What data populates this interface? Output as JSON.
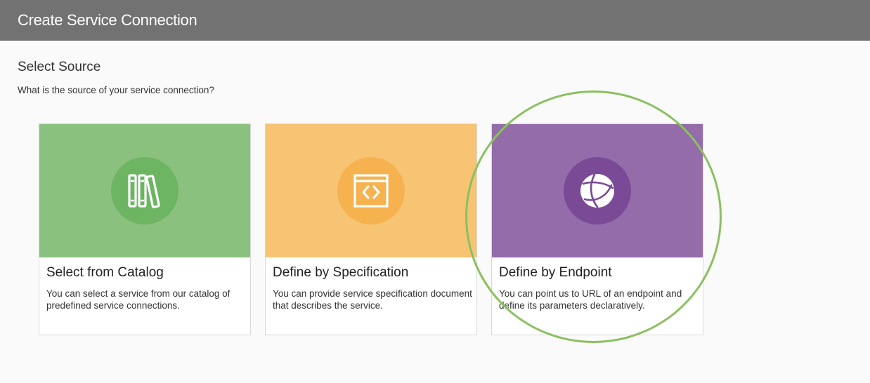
{
  "header": {
    "title": "Create Service Connection",
    "background": "#727272"
  },
  "section": {
    "title": "Select Source",
    "subtitle": "What is the source of your service connection?"
  },
  "cards": [
    {
      "title": "Select from Catalog",
      "description": "You can select a service from our catalog of predefined service connections.",
      "icon": "books-icon",
      "banner_color": "#8bc17f",
      "circle_color": "#6db463"
    },
    {
      "title": "Define by Specification",
      "description": "You can provide service specification document that describes the service.",
      "icon": "code-window-icon",
      "banner_color": "#f7c474",
      "circle_color": "#f5b24f"
    },
    {
      "title": "Define by Endpoint",
      "description": "You can point us to URL of an endpoint and define its parameters declaratively.",
      "icon": "globe-orbit-icon",
      "banner_color": "#946caa",
      "circle_color": "#7a4a97"
    }
  ],
  "highlight": {
    "target": "Define by Endpoint",
    "color": "#8bc060"
  }
}
